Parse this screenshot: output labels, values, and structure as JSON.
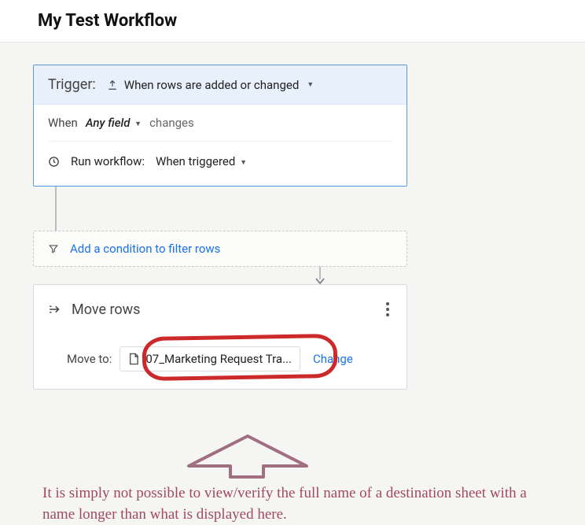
{
  "header": {
    "title": "My Test Workflow"
  },
  "trigger": {
    "label": "Trigger:",
    "type_label": "When rows are added or changed",
    "when_label": "When",
    "field_label": "Any field",
    "changes_label": "changes",
    "run_label": "Run workflow:",
    "run_value": "When triggered"
  },
  "condition": {
    "link_label": "Add a condition to filter rows"
  },
  "action": {
    "title": "Move rows",
    "moveto_label": "Move to:",
    "destination": "07_Marketing Request Tra...",
    "change_label": "Change"
  },
  "annotation": {
    "caption": "It is simply not possible to view/verify the full name of a destination sheet with a name longer than what is displayed here."
  },
  "icons": {
    "upload": "upload-icon",
    "clock": "clock-icon",
    "filter": "filter-icon",
    "move": "move-rows-icon",
    "sheet": "sheet-icon",
    "kebab": "more-icon"
  }
}
